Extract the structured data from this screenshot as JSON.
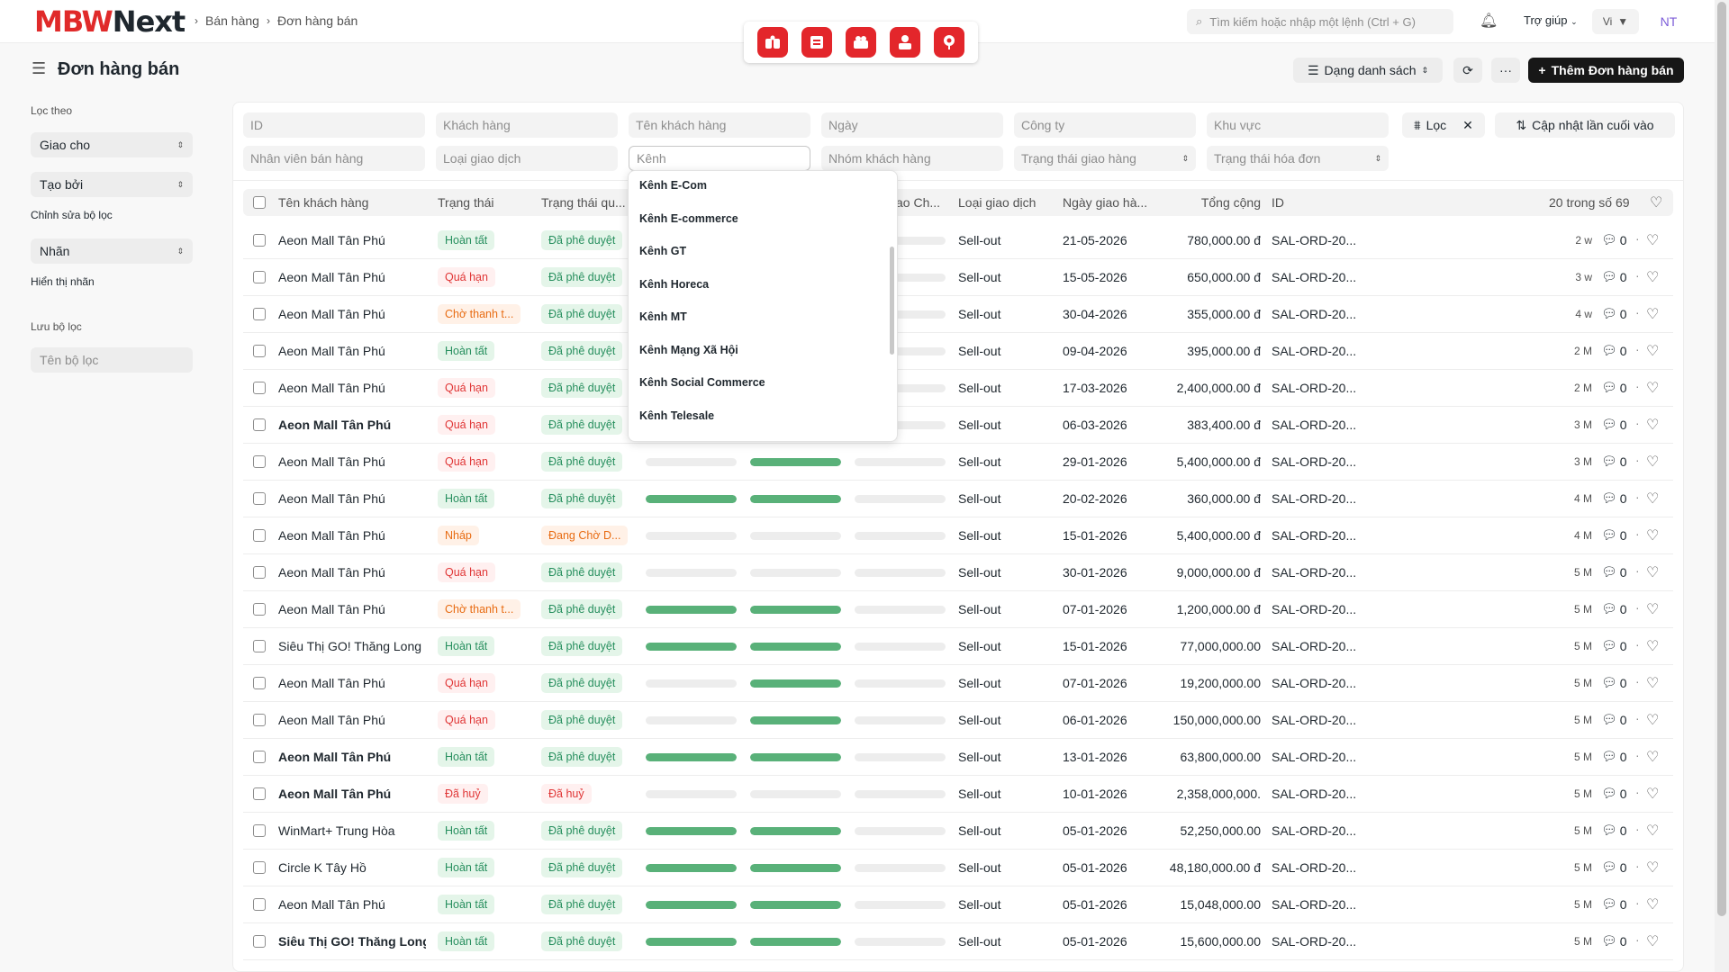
{
  "navbar": {
    "logo_mbw": "MBW",
    "logo_next": "Next",
    "breadcrumb": [
      "Bán hàng",
      "Đơn hàng bán"
    ],
    "search_placeholder": "Tìm kiếm hoặc nhập một lệnh (Ctrl + G)",
    "help": "Trợ giúp",
    "lang": "Vi",
    "avatar": "NT",
    "app_icons": [
      "app-icon-1",
      "app-icon-2",
      "app-icon-3",
      "app-icon-4",
      "app-icon-5"
    ]
  },
  "header": {
    "title": "Đơn hàng bán",
    "view_label": "Dạng danh sách",
    "add_label": "Thêm Đơn hàng bán"
  },
  "sidebar": {
    "filter_by": "Lọc theo",
    "assigned_to": "Giao cho",
    "created_by": "Tạo bởi",
    "edit_filters": "Chỉnh sửa bộ lọc",
    "tags": "Nhãn",
    "show_tags": "Hiển thị nhãn",
    "save_filter": "Lưu bộ lọc",
    "filter_name_placeholder": "Tên bộ lọc"
  },
  "filters": {
    "id": "ID",
    "customer": "Khách hàng",
    "customer_name": "Tên khách hàng",
    "date": "Ngày",
    "company": "Công ty",
    "region": "Khu vực",
    "sales_person": "Nhân viên bán hàng",
    "transaction_type": "Loại giao dịch",
    "channel": "Kênh",
    "customer_group": "Nhóm khách hàng",
    "delivery_status": "Trạng thái giao hàng",
    "billing_status": "Trạng thái hóa đơn",
    "filter_btn": "Lọc",
    "sort_label": "Cập nhật lần cuối vào"
  },
  "table": {
    "columns": {
      "name": "Tên khách hàng",
      "status": "Trạng thái",
      "approval": "Trạng thái qu...",
      "delivery": "ao Ch...",
      "type": "Loại giao dịch",
      "date": "Ngày giao hà...",
      "total": "Tổng cộng",
      "id": "ID",
      "count": "20 trong số 69"
    },
    "rows": [
      {
        "name": "Aeon Mall Tân Phú",
        "bold": false,
        "status": "Hoàn tất",
        "status_color": "green",
        "approval": "Đã phê duyệt",
        "approval_color": "green",
        "p1": 0,
        "p2": 0,
        "p3": 0,
        "type": "Sell-out",
        "date": "21-05-2026",
        "total": "780,000.00 đ",
        "id": "SAL-ORD-20...",
        "age": "2 w",
        "comments": "0"
      },
      {
        "name": "Aeon Mall Tân Phú",
        "bold": false,
        "status": "Quá hạn",
        "status_color": "red",
        "approval": "Đã phê duyệt",
        "approval_color": "green",
        "p1": 0,
        "p2": 0,
        "p3": 0,
        "type": "Sell-out",
        "date": "15-05-2026",
        "total": "650,000.00 đ",
        "id": "SAL-ORD-20...",
        "age": "3 w",
        "comments": "0"
      },
      {
        "name": "Aeon Mall Tân Phú",
        "bold": false,
        "status": "Chờ thanh t...",
        "status_color": "orange",
        "approval": "Đã phê duyệt",
        "approval_color": "green",
        "p1": 0,
        "p2": 0,
        "p3": 0,
        "type": "Sell-out",
        "date": "30-04-2026",
        "total": "355,000.00 đ",
        "id": "SAL-ORD-20...",
        "age": "4 w",
        "comments": "0"
      },
      {
        "name": "Aeon Mall Tân Phú",
        "bold": false,
        "status": "Hoàn tất",
        "status_color": "green",
        "approval": "Đã phê duyệt",
        "approval_color": "green",
        "p1": 0,
        "p2": 0,
        "p3": 0,
        "type": "Sell-out",
        "date": "09-04-2026",
        "total": "395,000.00 đ",
        "id": "SAL-ORD-20...",
        "age": "2 M",
        "comments": "0"
      },
      {
        "name": "Aeon Mall Tân Phú",
        "bold": false,
        "status": "Quá hạn",
        "status_color": "red",
        "approval": "Đã phê duyệt",
        "approval_color": "green",
        "p1": 0,
        "p2": 0,
        "p3": 0,
        "type": "Sell-out",
        "date": "17-03-2026",
        "total": "2,400,000.00 đ",
        "id": "SAL-ORD-20...",
        "age": "2 M",
        "comments": "0"
      },
      {
        "name": "Aeon Mall Tân Phú",
        "bold": true,
        "status": "Quá hạn",
        "status_color": "red",
        "approval": "Đã phê duyệt",
        "approval_color": "green",
        "p1": 0,
        "p2": 0,
        "p3": 0,
        "type": "Sell-out",
        "date": "06-03-2026",
        "total": "383,400.00 đ",
        "id": "SAL-ORD-20...",
        "age": "3 M",
        "comments": "0"
      },
      {
        "name": "Aeon Mall Tân Phú",
        "bold": false,
        "status": "Quá hạn",
        "status_color": "red",
        "approval": "Đã phê duyệt",
        "approval_color": "green",
        "p1": 0,
        "p2": 100,
        "p3": 0,
        "type": "Sell-out",
        "date": "29-01-2026",
        "total": "5,400,000.00 đ",
        "id": "SAL-ORD-20...",
        "age": "3 M",
        "comments": "0"
      },
      {
        "name": "Aeon Mall Tân Phú",
        "bold": false,
        "status": "Hoàn tất",
        "status_color": "green",
        "approval": "Đã phê duyệt",
        "approval_color": "green",
        "p1": 100,
        "p2": 100,
        "p3": 0,
        "type": "Sell-out",
        "date": "20-02-2026",
        "total": "360,000.00 đ",
        "id": "SAL-ORD-20...",
        "age": "4 M",
        "comments": "0"
      },
      {
        "name": "Aeon Mall Tân Phú",
        "bold": false,
        "status": "Nháp",
        "status_color": "orange",
        "approval": "Đang Chờ D...",
        "approval_color": "orange",
        "p1": 0,
        "p2": 0,
        "p3": 0,
        "type": "Sell-out",
        "date": "15-01-2026",
        "total": "5,400,000.00 đ",
        "id": "SAL-ORD-20...",
        "age": "4 M",
        "comments": "0"
      },
      {
        "name": "Aeon Mall Tân Phú",
        "bold": false,
        "status": "Quá hạn",
        "status_color": "red",
        "approval": "Đã phê duyệt",
        "approval_color": "green",
        "p1": 0,
        "p2": 0,
        "p3": 0,
        "type": "Sell-out",
        "date": "30-01-2026",
        "total": "9,000,000.00 đ",
        "id": "SAL-ORD-20...",
        "age": "5 M",
        "comments": "0"
      },
      {
        "name": "Aeon Mall Tân Phú",
        "bold": false,
        "status": "Chờ thanh t...",
        "status_color": "orange",
        "approval": "Đã phê duyệt",
        "approval_color": "green",
        "p1": 100,
        "p2": 100,
        "p3": 0,
        "type": "Sell-out",
        "date": "07-01-2026",
        "total": "1,200,000.00 đ",
        "id": "SAL-ORD-20...",
        "age": "5 M",
        "comments": "0"
      },
      {
        "name": "Siêu Thị GO! Thăng Long",
        "bold": false,
        "status": "Hoàn tất",
        "status_color": "green",
        "approval": "Đã phê duyệt",
        "approval_color": "green",
        "p1": 100,
        "p2": 100,
        "p3": 0,
        "type": "Sell-out",
        "date": "15-01-2026",
        "total": "77,000,000.00",
        "id": "SAL-ORD-20...",
        "age": "5 M",
        "comments": "0"
      },
      {
        "name": "Aeon Mall Tân Phú",
        "bold": false,
        "status": "Quá hạn",
        "status_color": "red",
        "approval": "Đã phê duyệt",
        "approval_color": "green",
        "p1": 0,
        "p2": 100,
        "p3": 0,
        "type": "Sell-out",
        "date": "07-01-2026",
        "total": "19,200,000.00",
        "id": "SAL-ORD-20...",
        "age": "5 M",
        "comments": "0"
      },
      {
        "name": "Aeon Mall Tân Phú",
        "bold": false,
        "status": "Quá hạn",
        "status_color": "red",
        "approval": "Đã phê duyệt",
        "approval_color": "green",
        "p1": 0,
        "p2": 100,
        "p3": 0,
        "type": "Sell-out",
        "date": "06-01-2026",
        "total": "150,000,000.00",
        "id": "SAL-ORD-20...",
        "age": "5 M",
        "comments": "0"
      },
      {
        "name": "Aeon Mall Tân Phú",
        "bold": true,
        "status": "Hoàn tất",
        "status_color": "green",
        "approval": "Đã phê duyệt",
        "approval_color": "green",
        "p1": 100,
        "p2": 100,
        "p3": 0,
        "type": "Sell-out",
        "date": "13-01-2026",
        "total": "63,800,000.00",
        "id": "SAL-ORD-20...",
        "age": "5 M",
        "comments": "0"
      },
      {
        "name": "Aeon Mall Tân Phú",
        "bold": true,
        "status": "Đã huỷ",
        "status_color": "red",
        "approval": "Đã huỷ",
        "approval_color": "red",
        "p1": 0,
        "p2": 0,
        "p3": 0,
        "type": "Sell-out",
        "date": "10-01-2026",
        "total": "2,358,000,000.",
        "id": "SAL-ORD-20...",
        "age": "5 M",
        "comments": "0"
      },
      {
        "name": "WinMart+ Trung Hòa",
        "bold": false,
        "status": "Hoàn tất",
        "status_color": "green",
        "approval": "Đã phê duyệt",
        "approval_color": "green",
        "p1": 100,
        "p2": 100,
        "p3": 0,
        "type": "Sell-out",
        "date": "05-01-2026",
        "total": "52,250,000.00",
        "id": "SAL-ORD-20...",
        "age": "5 M",
        "comments": "0"
      },
      {
        "name": "Circle K Tây Hồ",
        "bold": false,
        "status": "Hoàn tất",
        "status_color": "green",
        "approval": "Đã phê duyệt",
        "approval_color": "green",
        "p1": 100,
        "p2": 100,
        "p3": 0,
        "type": "Sell-out",
        "date": "05-01-2026",
        "total": "48,180,000.00 đ",
        "id": "SAL-ORD-20...",
        "age": "5 M",
        "comments": "0"
      },
      {
        "name": "Aeon Mall Tân Phú",
        "bold": false,
        "status": "Hoàn tất",
        "status_color": "green",
        "approval": "Đã phê duyệt",
        "approval_color": "green",
        "p1": 100,
        "p2": 100,
        "p3": 0,
        "type": "Sell-out",
        "date": "05-01-2026",
        "total": "15,048,000.00",
        "id": "SAL-ORD-20...",
        "age": "5 M",
        "comments": "0"
      },
      {
        "name": "Siêu Thị GO! Thăng Long",
        "bold": true,
        "status": "Hoàn tất",
        "status_color": "green",
        "approval": "Đã phê duyệt",
        "approval_color": "green",
        "p1": 100,
        "p2": 100,
        "p3": 0,
        "type": "Sell-out",
        "date": "05-01-2026",
        "total": "15,600,000.00",
        "id": "SAL-ORD-20...",
        "age": "5 M",
        "comments": "0"
      }
    ]
  },
  "dropdown": {
    "items": [
      "Kênh E-Com",
      "Kênh E-commerce",
      "Kênh GT",
      "Kênh Horeca",
      "Kênh MT",
      "Kênh Mạng Xã Hội",
      "Kênh Social Commerce",
      "Kênh Telesale"
    ]
  }
}
